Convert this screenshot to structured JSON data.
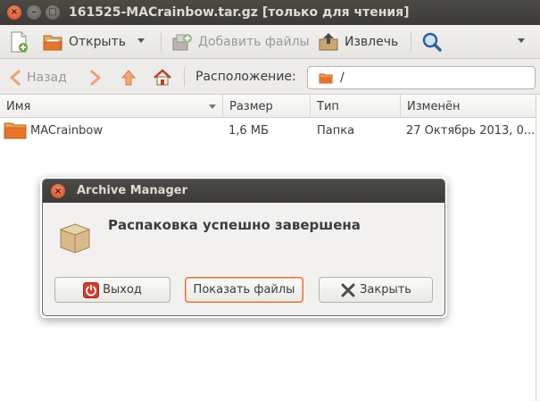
{
  "window": {
    "title": "161525-MACrainbow.tar.gz [только для чтения]",
    "close_glyph": "×",
    "min_glyph": "–",
    "max_glyph": "□"
  },
  "toolbar": {
    "new_icon": "new-archive-icon",
    "open_label": "Открыть",
    "add_files_label": "Добавить файлы",
    "extract_label": "Извлечь",
    "search_icon": "search-icon"
  },
  "location_bar": {
    "back_label": "Назад",
    "location_label": "Расположение:",
    "location_value": "/"
  },
  "file_list": {
    "columns": [
      "Имя",
      "Размер",
      "Тип",
      "Изменён"
    ],
    "rows": [
      {
        "name": "MACrainbow",
        "size": "1,6 МБ",
        "type": "Папка",
        "modified": "27 Октябрь 2013, 0..."
      }
    ]
  },
  "dialog": {
    "title": "Archive Manager",
    "message": "Распаковка успешно завершена",
    "buttons": {
      "quit": "Выход",
      "show_files": "Показать файлы",
      "close": "Закрыть"
    }
  },
  "colors": {
    "titlebar": "#3c3b37",
    "accent_orange": "#e2703a",
    "folder_orange": "#e8742c",
    "quit_red": "#d43c2a"
  }
}
